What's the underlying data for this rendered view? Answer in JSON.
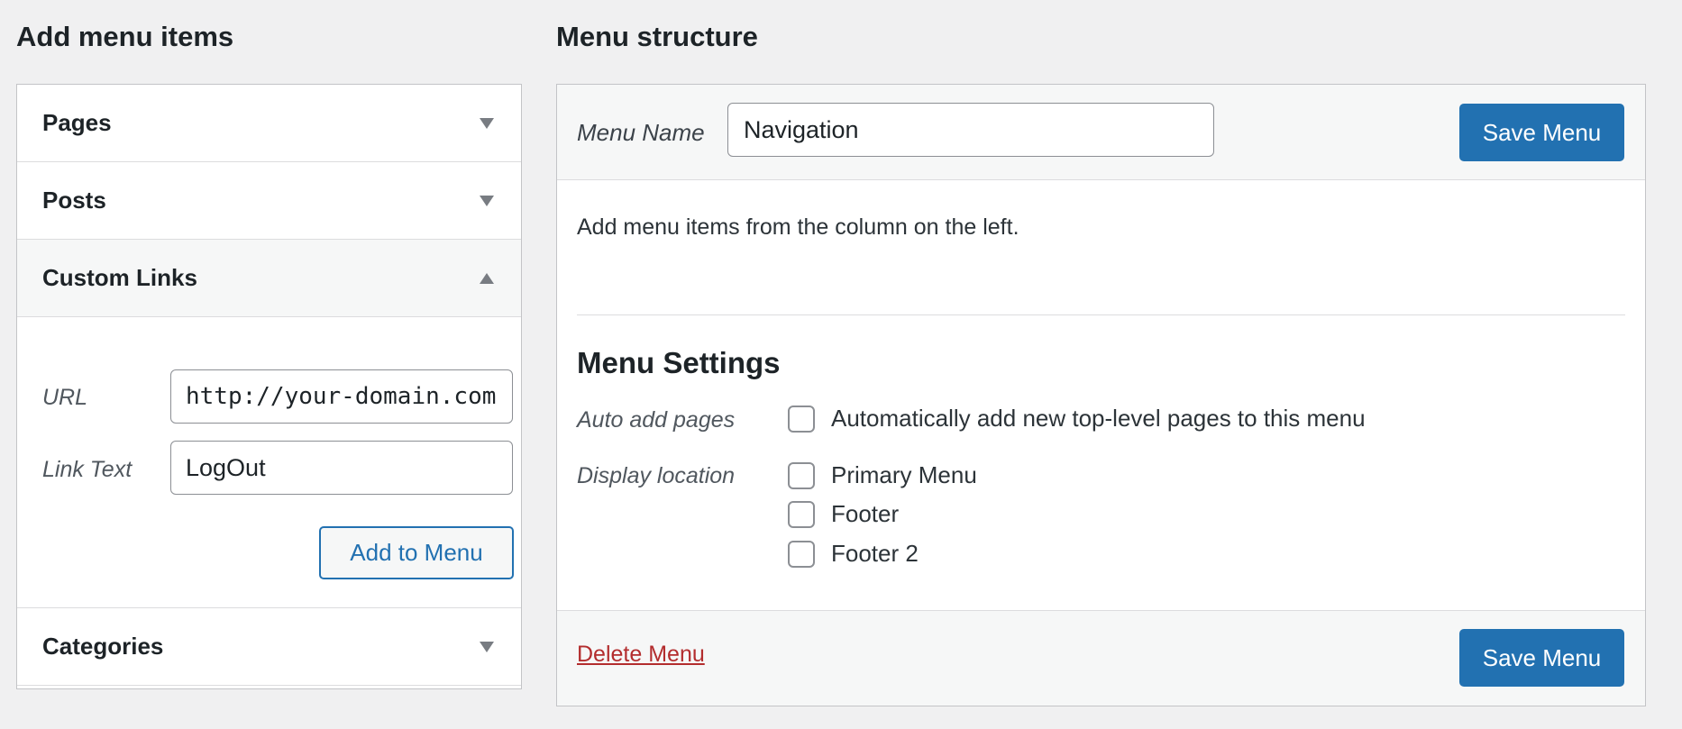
{
  "left": {
    "title": "Add menu items",
    "sections": {
      "pages": "Pages",
      "posts": "Posts",
      "custom_links": "Custom Links",
      "categories": "Categories"
    },
    "custom_links": {
      "url_label": "URL",
      "url_value": "http://your-domain.com",
      "link_text_label": "Link Text",
      "link_text_value": "LogOut",
      "add_button": "Add to Menu"
    }
  },
  "right": {
    "title": "Menu structure",
    "menu_name_label": "Menu Name",
    "menu_name_value": "Navigation",
    "save_button": "Save Menu",
    "hint": "Add menu items from the column on the left.",
    "settings": {
      "title": "Menu Settings",
      "auto_add_label": "Auto add pages",
      "auto_add_option": "Automatically add new top-level pages to this menu",
      "display_location_label": "Display location",
      "locations": [
        "Primary Menu",
        "Footer",
        "Footer 2"
      ]
    },
    "delete_link": "Delete Menu"
  },
  "colors": {
    "accent": "#2271b1",
    "danger": "#b32d2e",
    "background": "#f0f0f1"
  },
  "icons": {
    "collapsed": "triangle-down-icon",
    "expanded": "triangle-up-icon"
  }
}
